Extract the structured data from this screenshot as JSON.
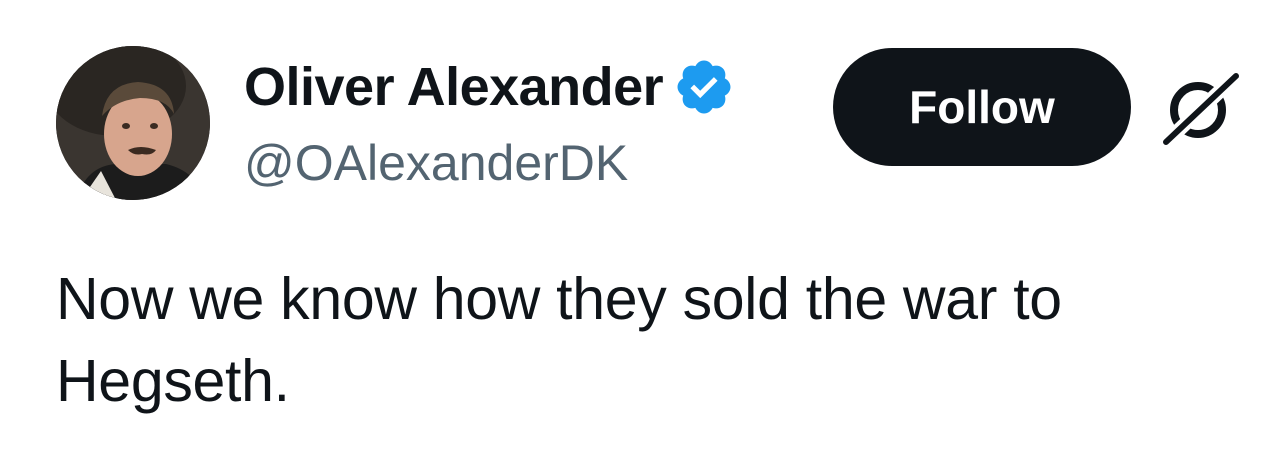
{
  "author": {
    "display_name": "Oliver Alexander",
    "handle": "@OAlexanderDK",
    "verified": true,
    "verified_color": "#1d9bf0"
  },
  "actions": {
    "follow_label": "Follow",
    "follow_bg": "#0f1419",
    "more_icon": "grok-icon"
  },
  "tweet": {
    "text": "Now we know how they sold the war to Hegseth."
  }
}
